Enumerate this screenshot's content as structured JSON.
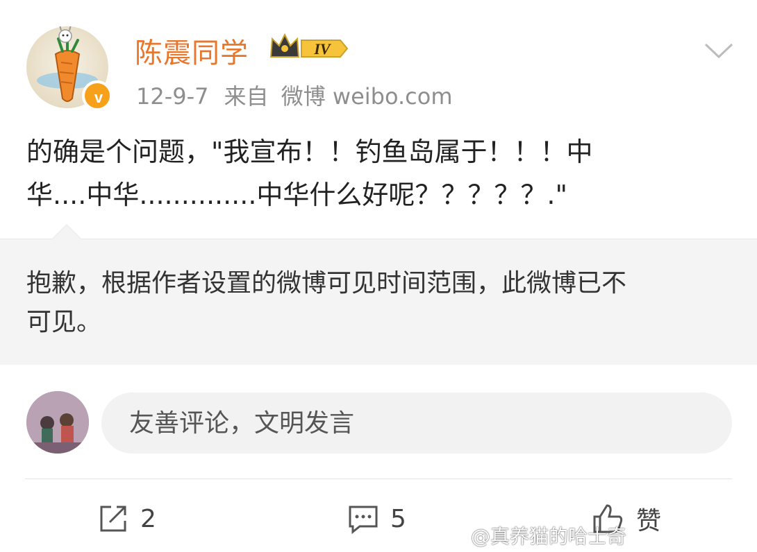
{
  "post": {
    "username": "陈震同学",
    "badge_level": "IV",
    "date": "12-9-7",
    "source_prefix": "来自",
    "source": "微博 weibo.com",
    "text_line1": "的确是个问题，\"我宣布！！钓鱼岛属于！！！中",
    "text_line2": "华....中华..............中华什么好呢？？？？？.\""
  },
  "notice": {
    "line1": "抱歉，根据作者设置的微博可见时间范围，此微博已不",
    "line2": "可见。"
  },
  "comment": {
    "placeholder": "友善评论，文明发言"
  },
  "actions": {
    "repost_count": "2",
    "comment_count": "5",
    "like_label": "赞"
  },
  "watermark": {
    "text": "@真养猫的哈士奇"
  },
  "colors": {
    "username": "#e8762b",
    "verified": "#f7a11b",
    "meta": "#8e8e8e",
    "notice_bg": "#f4f4f4"
  }
}
